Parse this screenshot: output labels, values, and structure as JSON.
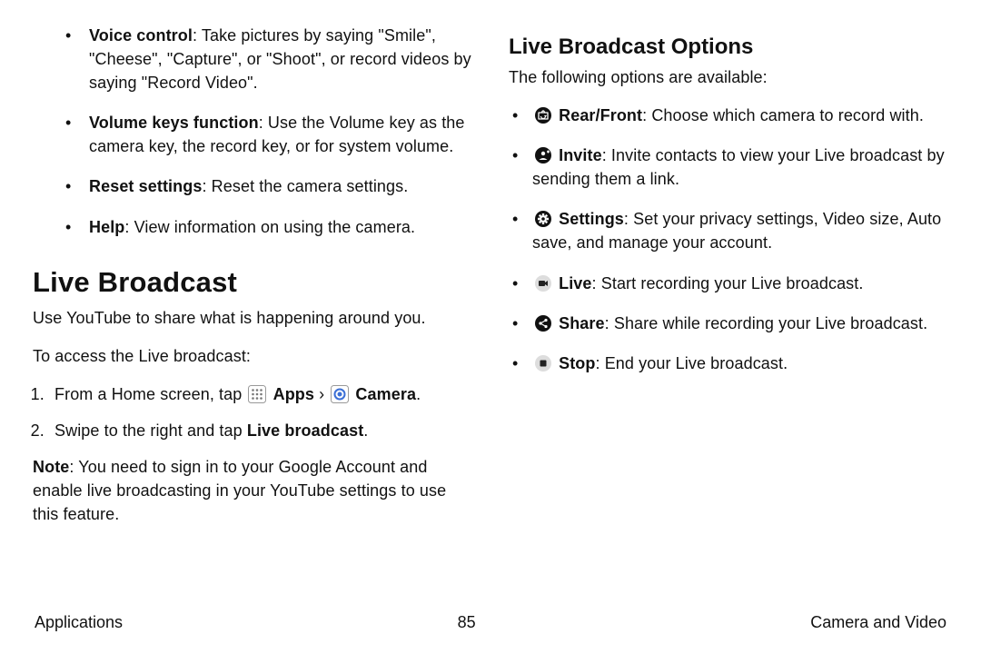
{
  "left": {
    "sub": [
      {
        "term": "Voice control",
        "text": ": Take pictures by saying \"Smile\", \"Cheese\", \"Capture\", or \"Shoot\", or record videos by saying \"Record Video\"."
      },
      {
        "term": "Volume keys function",
        "text": ": Use the Volume key as the camera key, the record key, or for system volume."
      },
      {
        "term": "Reset settings",
        "text": ": Reset the camera settings."
      },
      {
        "term": "Help",
        "text": ": View information on using the camera."
      }
    ],
    "h1": "Live Broadcast",
    "intro": "Use YouTube to share what is happening around you.",
    "access": "To access the Live broadcast:",
    "steps": {
      "s1_pre": "From a Home screen, tap ",
      "s1_apps": " Apps",
      "s1_chevron": " › ",
      "s1_camera": " Camera",
      "s1_post": ".",
      "s2_pre": "Swipe to the right and tap ",
      "s2_live": "Live broadcast",
      "s2_post": "."
    },
    "note_label": "Note",
    "note_text": ": You need to sign in to your Google Account and enable live broadcasting in your YouTube settings to use this feature."
  },
  "right": {
    "h2": "Live Broadcast Options",
    "intro": "The following options are available:",
    "items": [
      {
        "icon": "camera-switch-icon",
        "term": "Rear/Front",
        "text": ": Choose which camera to record with."
      },
      {
        "icon": "invite-icon",
        "term": "Invite",
        "text": ": Invite contacts to view your Live broadcast by sending them a link."
      },
      {
        "icon": "gear-icon",
        "term": "Settings",
        "text": ": Set your privacy settings, Video size, Auto save, and manage your account."
      },
      {
        "icon": "live-icon",
        "term": "Live",
        "text": ": Start recording your Live broadcast."
      },
      {
        "icon": "share-icon",
        "term": "Share",
        "text": ": Share while recording your Live broadcast."
      },
      {
        "icon": "stop-icon",
        "term": "Stop",
        "text": ": End your Live broadcast."
      }
    ]
  },
  "footer": {
    "left": "Applications",
    "center": "85",
    "right": "Camera and Video"
  }
}
